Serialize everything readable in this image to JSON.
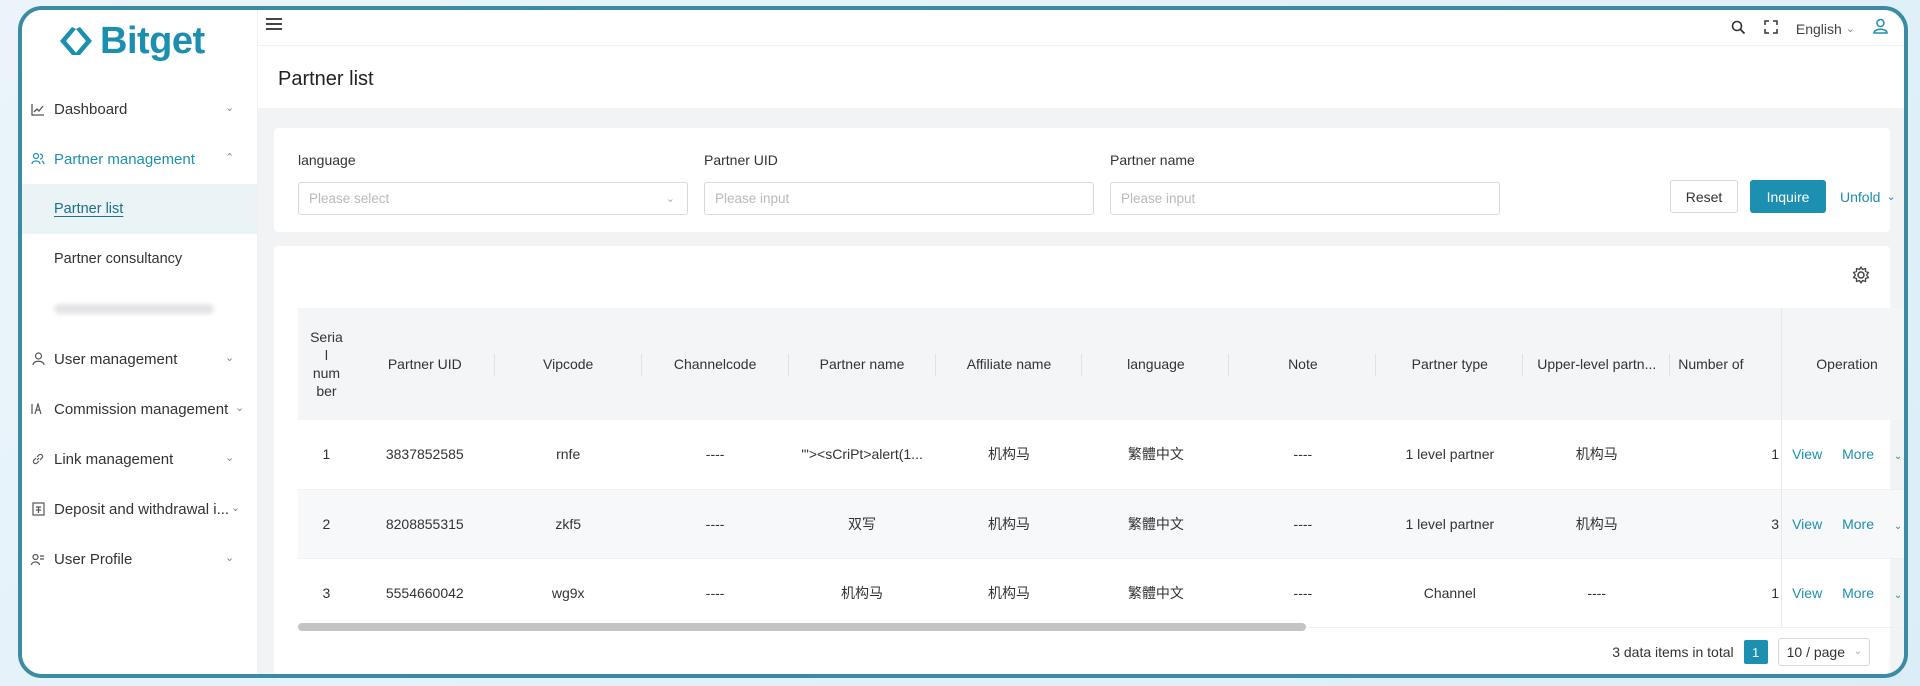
{
  "brand": {
    "name": "Bitget",
    "color": "#1d8fb0"
  },
  "topbar": {
    "language": "English"
  },
  "sidebar": {
    "items": [
      {
        "label": "Dashboard",
        "icon": "chart-icon"
      },
      {
        "label": "Partner management",
        "icon": "partner-icon",
        "sub": [
          "Partner list",
          "Partner consultancy"
        ]
      },
      {
        "label": "User management",
        "icon": "user-icon"
      },
      {
        "label": "Commission management",
        "icon": "commission-icon"
      },
      {
        "label": "Link management",
        "icon": "link-icon"
      },
      {
        "label": "Deposit and withdrawal i...",
        "icon": "deposit-icon"
      },
      {
        "label": "User Profile",
        "icon": "profile-icon"
      }
    ]
  },
  "page": {
    "title": "Partner list"
  },
  "filters": {
    "language": {
      "label": "language",
      "placeholder": "Please select"
    },
    "uid": {
      "label": "Partner UID",
      "placeholder": "Please input"
    },
    "name": {
      "label": "Partner name",
      "placeholder": "Please input"
    },
    "reset": "Reset",
    "inquire": "Inquire",
    "unfold": "Unfold"
  },
  "table": {
    "headers": [
      "Seria\nl\nnum\nber",
      "Partner UID",
      "Vipcode",
      "Channelcode",
      "Partner name",
      "Affiliate name",
      "language",
      "Note",
      "Partner type",
      "Upper-level partn...",
      "Number of",
      "Operation"
    ],
    "rows": [
      {
        "serial": "1",
        "uid": "3837852585",
        "vip": "rnfe",
        "channel": "----",
        "partner": "'\"><sCriPt>alert(1...",
        "affiliate": "机构马",
        "language": "繁體中文",
        "note": "----",
        "type": "1 level partner",
        "upper": "机构马",
        "number": "1",
        "view": "View",
        "more": "More"
      },
      {
        "serial": "2",
        "uid": "8208855315",
        "vip": "zkf5",
        "channel": "----",
        "partner": "双写",
        "affiliate": "机构马",
        "language": "繁體中文",
        "note": "----",
        "type": "1 level partner",
        "upper": "机构马",
        "number": "3",
        "view": "View",
        "more": "More"
      },
      {
        "serial": "3",
        "uid": "5554660042",
        "vip": "wg9x",
        "channel": "----",
        "partner": "机构马",
        "affiliate": "机构马",
        "language": "繁體中文",
        "note": "----",
        "type": "Channel",
        "upper": "----",
        "number": "1",
        "view": "View",
        "more": "More"
      }
    ]
  },
  "footer": {
    "total": "3 data items in total",
    "page": "1",
    "page_size": "10 / page"
  }
}
